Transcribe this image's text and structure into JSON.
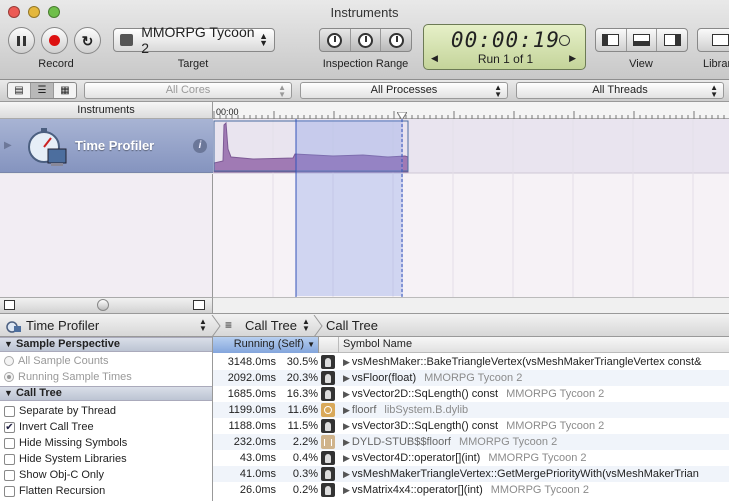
{
  "window": {
    "title": "Instruments"
  },
  "toolbar": {
    "record_label": "Record",
    "target_label": "Target",
    "target_value": "MMORPG Tycoon 2",
    "inspection_label": "Inspection Range",
    "time": "00:00:19",
    "run": "Run 1 of 1",
    "view_label": "View",
    "library_label": "Library"
  },
  "filterbar": {
    "cores": "All Cores",
    "processes": "All Processes",
    "threads": "All Threads"
  },
  "instruments": {
    "header": "Instruments",
    "timeline_start": "00:00",
    "items": [
      {
        "name": "Time Profiler"
      }
    ]
  },
  "jumpbar": {
    "instrument": "Time Profiler",
    "view": "Call Tree",
    "crumb": "Call Tree"
  },
  "sidebar": {
    "sections": [
      {
        "title": "Sample Perspective",
        "options": [
          {
            "label": "All Sample Counts",
            "selected": false
          },
          {
            "label": "Running Sample Times",
            "selected": true
          }
        ]
      },
      {
        "title": "Call Tree",
        "options": [
          {
            "label": "Separate by Thread",
            "checked": false
          },
          {
            "label": "Invert Call Tree",
            "checked": true
          },
          {
            "label": "Hide Missing Symbols",
            "checked": false
          },
          {
            "label": "Hide System Libraries",
            "checked": false
          },
          {
            "label": "Show Obj-C Only",
            "checked": false
          },
          {
            "label": "Flatten Recursion",
            "checked": false
          }
        ]
      }
    ]
  },
  "table": {
    "columns": {
      "running": "Running (Self)",
      "symbol": "Symbol Name"
    },
    "rows": [
      {
        "ms": "3148.0ms",
        "pct": "30.5%",
        "icon": "user-code-icon",
        "symbol": "vsMeshMaker::BakeTriangleVertex(vsMeshMakerTriangleVertex const&",
        "lib": ""
      },
      {
        "ms": "2092.0ms",
        "pct": "20.3%",
        "icon": "user-code-icon",
        "symbol": "vsFloor(float)",
        "lib": "MMORPG Tycoon 2"
      },
      {
        "ms": "1685.0ms",
        "pct": "16.3%",
        "icon": "user-code-icon",
        "symbol": "vsVector2D::SqLength() const",
        "lib": "MMORPG Tycoon 2"
      },
      {
        "ms": "1199.0ms",
        "pct": "11.6%",
        "icon": "system-library-icon",
        "symbol": "floorf",
        "lib": "libSystem.B.dylib"
      },
      {
        "ms": "1188.0ms",
        "pct": "11.5%",
        "icon": "user-code-icon",
        "symbol": "vsVector3D::SqLength() const",
        "lib": "MMORPG Tycoon 2"
      },
      {
        "ms": "232.0ms",
        "pct": "2.2%",
        "icon": "stub-icon",
        "symbol": "DYLD-STUB$$floorf",
        "lib": "MMORPG Tycoon 2"
      },
      {
        "ms": "43.0ms",
        "pct": "0.4%",
        "icon": "user-code-icon",
        "symbol": "vsVector4D::operator[](int)",
        "lib": "MMORPG Tycoon 2"
      },
      {
        "ms": "41.0ms",
        "pct": "0.3%",
        "icon": "user-code-icon",
        "symbol": "vsMeshMakerTriangleVertex::GetMergePriorityWith(vsMeshMakerTrian",
        "lib": ""
      },
      {
        "ms": "26.0ms",
        "pct": "0.2%",
        "icon": "user-code-icon",
        "symbol": "vsMatrix4x4::operator[](int)",
        "lib": "MMORPG Tycoon 2"
      }
    ]
  }
}
